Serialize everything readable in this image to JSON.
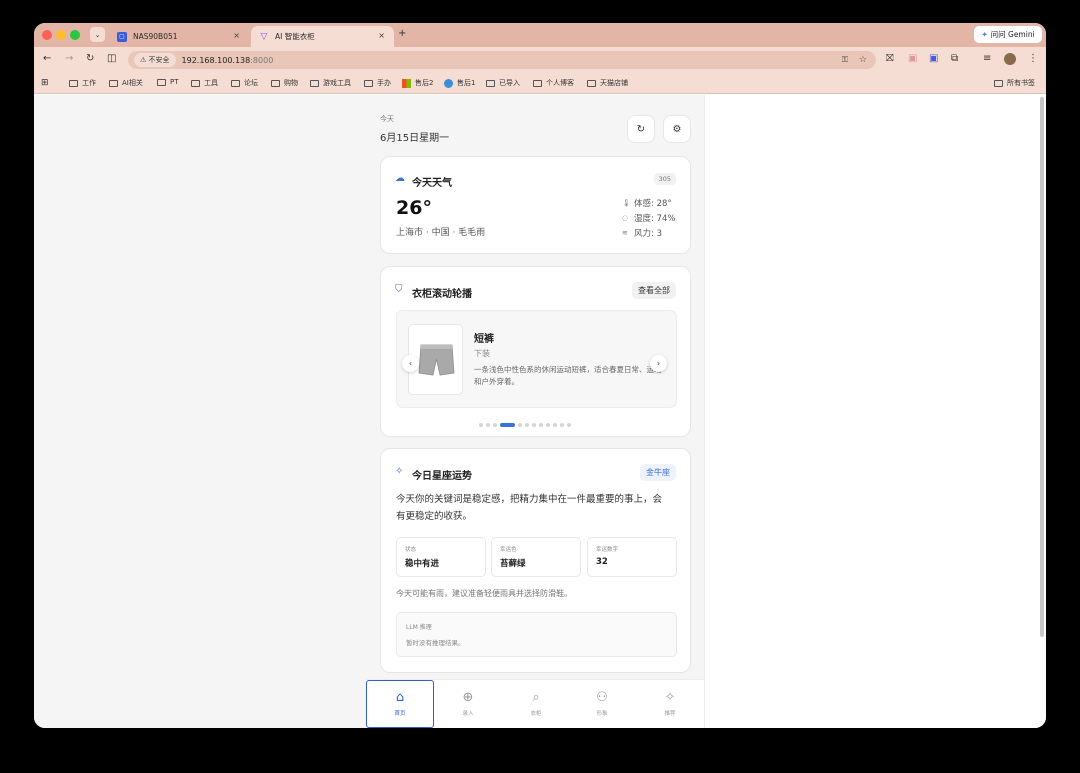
{
  "browser": {
    "tabs": [
      {
        "title": "NAS90B051",
        "close": "×"
      },
      {
        "title": "AI 智能衣柜",
        "close": "×"
      }
    ],
    "new_tab": "+",
    "gemini_label": "问问 Gemini",
    "address": {
      "security": "不安全",
      "url": "192.168.100.138",
      "port": ":8000"
    },
    "bookmarks": [
      "工作",
      "AI相关",
      "PT",
      "工具",
      "论坛",
      "购物",
      "游戏工具",
      "手办",
      "售后2",
      "售后1",
      "已导入",
      "个人博客",
      "天猫店铺"
    ],
    "all_bookmarks": "所有书签"
  },
  "header": {
    "today_label": "今天",
    "date": "6月15日星期一"
  },
  "weather": {
    "title": "今天天气",
    "code": "305",
    "temp": "26°",
    "location": "上海市 · 中国 · 毛毛雨",
    "feels": "体感: 28°",
    "humidity": "湿度: 74%",
    "wind": "风力: 3"
  },
  "wardrobe": {
    "title": "衣柜滚动轮播",
    "view_all": "查看全部",
    "item": {
      "name": "短裤",
      "category": "下装",
      "description": "一条浅色中性色系的休闲运动短裤，适合春夏日常、运动和户外穿着。"
    },
    "carousel": {
      "count": 12,
      "active_index": 3
    }
  },
  "horoscope": {
    "title": "今日星座运势",
    "sign": "金牛座",
    "summary": "今天你的关键词是稳定感，把精力集中在一件最重要的事上，会有更稳定的收获。",
    "tiles": [
      {
        "label": "状态",
        "value": "稳中有进"
      },
      {
        "label": "幸运色",
        "value": "苔藓绿"
      },
      {
        "label": "幸运数字",
        "value": "32"
      }
    ],
    "tip": "今天可能有雨，建议准备轻便雨具并选择防滑鞋。",
    "llm": {
      "label": "LLM 推理",
      "text": "暂时没有推理结果。"
    }
  },
  "bottom_nav": [
    {
      "label": "首页",
      "icon": "home-icon"
    },
    {
      "label": "录入",
      "icon": "plus-circle-icon"
    },
    {
      "label": "衣柜",
      "icon": "search-icon"
    },
    {
      "label": "形象",
      "icon": "user-icon"
    },
    {
      "label": "推荐",
      "icon": "sparkle-icon"
    }
  ],
  "colors": {
    "accent": "#2f5fd1",
    "tab_bar": "#e2b5a6",
    "toolbar": "#f5ddd4"
  }
}
